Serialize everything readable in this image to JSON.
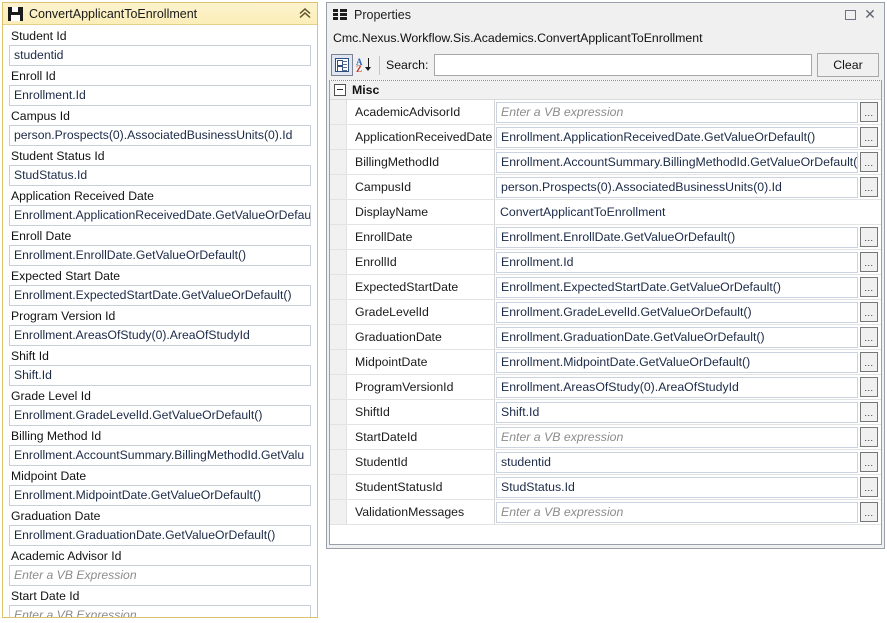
{
  "activity_panel": {
    "title": "ConvertApplicantToEnrollment",
    "icon": "floppy-disk-save-icon",
    "collapse_icon": "chevrons-up-icon",
    "header_color": "#fbeeb8",
    "border_color": "#dcc26a",
    "fields": [
      {
        "label": "Student Id",
        "value": "studentid",
        "is_placeholder": false
      },
      {
        "label": "Enroll Id",
        "value": "Enrollment.Id",
        "is_placeholder": false
      },
      {
        "label": "Campus Id",
        "value": "person.Prospects(0).AssociatedBusinessUnits(0).Id",
        "is_placeholder": false
      },
      {
        "label": "Student Status Id",
        "value": "StudStatus.Id",
        "is_placeholder": false
      },
      {
        "label": "Application Received Date",
        "value": "Enrollment.ApplicationReceivedDate.GetValueOrDefau",
        "is_placeholder": false
      },
      {
        "label": "Enroll Date",
        "value": "Enrollment.EnrollDate.GetValueOrDefault()",
        "is_placeholder": false
      },
      {
        "label": "Expected Start Date",
        "value": "Enrollment.ExpectedStartDate.GetValueOrDefault()",
        "is_placeholder": false
      },
      {
        "label": "Program Version Id",
        "value": "Enrollment.AreasOfStudy(0).AreaOfStudyId",
        "is_placeholder": false
      },
      {
        "label": "Shift Id",
        "value": "Shift.Id",
        "is_placeholder": false
      },
      {
        "label": "Grade Level Id",
        "value": "Enrollment.GradeLevelId.GetValueOrDefault()",
        "is_placeholder": false
      },
      {
        "label": "Billing Method Id",
        "value": "Enrollment.AccountSummary.BillingMethodId.GetValu",
        "is_placeholder": false
      },
      {
        "label": "Midpoint Date",
        "value": "Enrollment.MidpointDate.GetValueOrDefault()",
        "is_placeholder": false
      },
      {
        "label": "Graduation Date",
        "value": "Enrollment.GraduationDate.GetValueOrDefault()",
        "is_placeholder": false
      },
      {
        "label": "Academic Advisor Id",
        "value": "Enter a VB Expression",
        "is_placeholder": true
      },
      {
        "label": "Start Date Id",
        "value": "Enter a VB Expression",
        "is_placeholder": true
      }
    ]
  },
  "properties_window": {
    "title": "Properties",
    "title_icon": "properties-grid-icon",
    "maximize_icon": "maximize-icon",
    "close_icon": "close-icon",
    "object_path": "Cmc.Nexus.Workflow.Sis.Academics.ConvertApplicantToEnrollment",
    "toolbar": {
      "categorized_icon": "categorized-view-icon",
      "alphabetical_icon": "sort-alphabetical-icon",
      "search_label": "Search:",
      "search_value": "",
      "search_placeholder": "",
      "clear_label": "Clear"
    },
    "group": {
      "name": "Misc",
      "expander_icon": "collapse-minus-icon",
      "rows": [
        {
          "name": "AcademicAdvisorId",
          "value": "Enter a VB expression",
          "is_placeholder": true,
          "has_ellipsis": true
        },
        {
          "name": "ApplicationReceivedDate",
          "value": "Enrollment.ApplicationReceivedDate.GetValueOrDefault()",
          "is_placeholder": false,
          "has_ellipsis": true
        },
        {
          "name": "BillingMethodId",
          "value": "Enrollment.AccountSummary.BillingMethodId.GetValueOrDefault()",
          "is_placeholder": false,
          "has_ellipsis": true
        },
        {
          "name": "CampusId",
          "value": "person.Prospects(0).AssociatedBusinessUnits(0).Id",
          "is_placeholder": false,
          "has_ellipsis": true
        },
        {
          "name": "DisplayName",
          "value": "ConvertApplicantToEnrollment",
          "is_placeholder": false,
          "has_ellipsis": false
        },
        {
          "name": "EnrollDate",
          "value": "Enrollment.EnrollDate.GetValueOrDefault()",
          "is_placeholder": false,
          "has_ellipsis": true
        },
        {
          "name": "EnrollId",
          "value": "Enrollment.Id",
          "is_placeholder": false,
          "has_ellipsis": true
        },
        {
          "name": "ExpectedStartDate",
          "value": "Enrollment.ExpectedStartDate.GetValueOrDefault()",
          "is_placeholder": false,
          "has_ellipsis": true
        },
        {
          "name": "GradeLevelId",
          "value": "Enrollment.GradeLevelId.GetValueOrDefault()",
          "is_placeholder": false,
          "has_ellipsis": true
        },
        {
          "name": "GraduationDate",
          "value": "Enrollment.GraduationDate.GetValueOrDefault()",
          "is_placeholder": false,
          "has_ellipsis": true
        },
        {
          "name": "MidpointDate",
          "value": "Enrollment.MidpointDate.GetValueOrDefault()",
          "is_placeholder": false,
          "has_ellipsis": true
        },
        {
          "name": "ProgramVersionId",
          "value": "Enrollment.AreasOfStudy(0).AreaOfStudyId",
          "is_placeholder": false,
          "has_ellipsis": true
        },
        {
          "name": "ShiftId",
          "value": "Shift.Id",
          "is_placeholder": false,
          "has_ellipsis": true
        },
        {
          "name": "StartDateId",
          "value": "Enter a VB expression",
          "is_placeholder": true,
          "has_ellipsis": true
        },
        {
          "name": "StudentId",
          "value": "studentid",
          "is_placeholder": false,
          "has_ellipsis": true
        },
        {
          "name": "StudentStatusId",
          "value": "StudStatus.Id",
          "is_placeholder": false,
          "has_ellipsis": true
        },
        {
          "name": "ValidationMessages",
          "value": "Enter a VB expression",
          "is_placeholder": true,
          "has_ellipsis": true
        }
      ]
    }
  }
}
